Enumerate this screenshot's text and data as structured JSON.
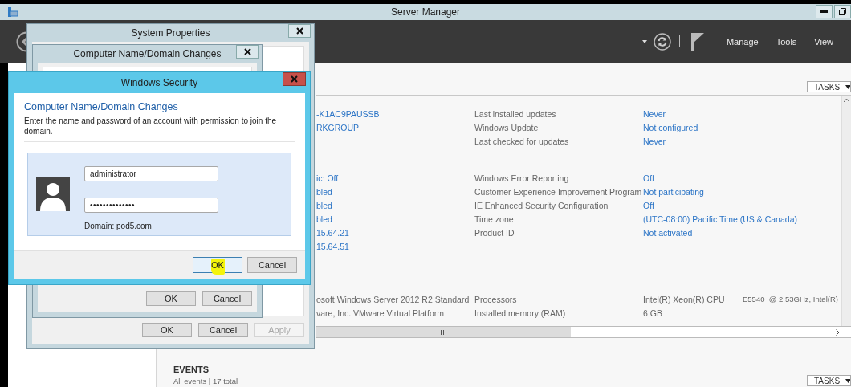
{
  "server_manager": {
    "title": "Server Manager",
    "menu": [
      "Manage",
      "Tools",
      "View"
    ],
    "properties": {
      "tasks_button": "TASKS",
      "groups": [
        {
          "rows": [
            [
              {
                "text": "-K1AC9PAUSSB",
                "link": true
              },
              {
                "text": "Last installed updates",
                "link": false
              },
              {
                "text": "Never",
                "link": true
              }
            ],
            [
              {
                "text": "RKGROUP",
                "link": true
              },
              {
                "text": "Windows Update",
                "link": false
              },
              {
                "text": "Not configured",
                "link": true
              }
            ],
            [
              null,
              {
                "text": "Last checked for updates",
                "link": false
              },
              {
                "text": "Never",
                "link": true
              }
            ]
          ]
        },
        {
          "rows": [
            [
              {
                "text": "ic: Off",
                "link": true
              },
              {
                "text": "Windows Error Reporting",
                "link": false
              },
              {
                "text": "Off",
                "link": true
              }
            ],
            [
              {
                "text": "bled",
                "link": true
              },
              {
                "text": "Customer Experience Improvement Program",
                "link": false
              },
              {
                "text": "Not participating",
                "link": true
              }
            ],
            [
              {
                "text": "bled",
                "link": true
              },
              {
                "text": "IE Enhanced Security Configuration",
                "link": false
              },
              {
                "text": "Off",
                "link": true
              }
            ],
            [
              {
                "text": "bled",
                "link": true
              },
              {
                "text": "Time zone",
                "link": false
              },
              {
                "text": "(UTC-08:00) Pacific Time (US & Canada)",
                "link": true
              }
            ],
            [
              {
                "text": "15.64.21",
                "link": true
              },
              {
                "text": "Product ID",
                "link": false
              },
              {
                "text": "Not activated",
                "link": true
              }
            ],
            [
              {
                "text": "15.64.51",
                "link": true
              }
            ]
          ]
        },
        {
          "rows": [
            [
              {
                "text": "osoft Windows Server 2012 R2 Standard",
                "link": false
              },
              {
                "text": "Processors",
                "link": false
              },
              {
                "text": "Intel(R) Xeon(R) CPU",
                "link": false
              },
              {
                "text": "E5540  @ 2.53GHz, Intel(R)",
                "link": false
              }
            ],
            [
              {
                "text": "vare, Inc. VMware Virtual Platform",
                "link": false
              },
              {
                "text": "Installed memory (RAM)",
                "link": false
              },
              {
                "text": "6 GB",
                "link": false
              }
            ]
          ]
        }
      ]
    },
    "events": {
      "title": "EVENTS",
      "summary": "All events | 17 total",
      "tasks_button": "TASKS"
    }
  },
  "system_properties": {
    "title": "System Properties",
    "buttons": [
      {
        "label": "OK",
        "disabled": false
      },
      {
        "label": "Cancel",
        "disabled": false
      },
      {
        "label": "Apply",
        "disabled": true
      }
    ]
  },
  "name_changes": {
    "title": "Computer Name/Domain Changes",
    "buttons": [
      {
        "label": "OK",
        "disabled": false
      },
      {
        "label": "Cancel",
        "disabled": false
      }
    ]
  },
  "windows_security": {
    "title": "Windows Security",
    "heading": "Computer Name/Domain Changes",
    "description": "Enter the name and password of an account with permission to join the domain.",
    "username": "administrator",
    "password": "••••••••••••••",
    "domain": "Domain: pod5.com",
    "buttons": [
      {
        "label": "OK",
        "disabled": false,
        "focused": true,
        "highlighted": true
      },
      {
        "label": "Cancel",
        "disabled": false,
        "focused": false,
        "highlighted": false
      }
    ]
  }
}
